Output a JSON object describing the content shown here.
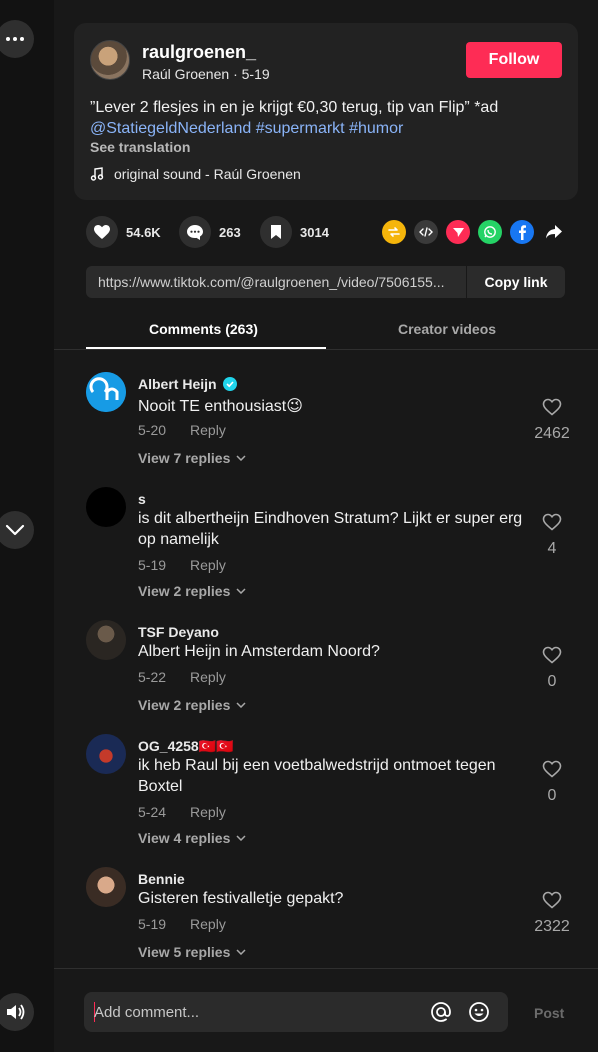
{
  "post": {
    "username": "raulgroenen_",
    "display_name": "Raúl Groenen",
    "date": "5-19",
    "follow_label": "Follow",
    "caption_text": "”Lever 2 flesjes in en je krijgt €0,30 terug, tip van Flip” *ad",
    "hashtags": [
      "@StatiegeldNederland",
      "#supermarkt",
      "#humor"
    ],
    "see_translation": "See translation",
    "sound": "original sound - Raúl Groenen"
  },
  "stats": {
    "likes": "54.6K",
    "comments": "263",
    "saves": "3014"
  },
  "share_icons": [
    "repost-icon",
    "embed-icon",
    "send-icon",
    "whatsapp-icon",
    "facebook-icon",
    "share-arrow-icon"
  ],
  "link": {
    "url": "https://www.tiktok.com/@raulgroenen_/video/7506155...",
    "copy_label": "Copy link"
  },
  "tabs": [
    {
      "label": "Comments (263)"
    },
    {
      "label": "Creator videos"
    }
  ],
  "comments": [
    {
      "name": "Albert Heijn",
      "verified": true,
      "text": "Nooit TE enthousiast😉",
      "date": "5-20",
      "reply": "Reply",
      "replies": "View 7 replies",
      "likes": "2462"
    },
    {
      "name": "s",
      "text": "is dit albertheijn Eindhoven Stratum? Lijkt er super erg op namelijk",
      "date": "5-19",
      "reply": "Reply",
      "replies": "View 2 replies",
      "likes": "4"
    },
    {
      "name": "TSF Deyano",
      "text": "Albert Heijn in Amsterdam Noord?",
      "date": "5-22",
      "reply": "Reply",
      "replies": "View 2 replies",
      "likes": "0"
    },
    {
      "name": "OG_4258🇹🇷🇹🇷",
      "text": "ik heb Raul bij een voetbalwedstrijd ontmoet tegen Boxtel",
      "date": "5-24",
      "reply": "Reply",
      "replies": "View 4 replies",
      "likes": "0"
    },
    {
      "name": "Bennie",
      "text": "Gisteren festivalletje gepakt?",
      "date": "5-19",
      "reply": "Reply",
      "replies": "View 5 replies",
      "likes": "2322"
    }
  ],
  "composer": {
    "placeholder": "Add comment...",
    "post_label": "Post"
  },
  "colors": {
    "accent": "#fe2c55",
    "link": "#8ab4f8",
    "background": "#181818"
  }
}
